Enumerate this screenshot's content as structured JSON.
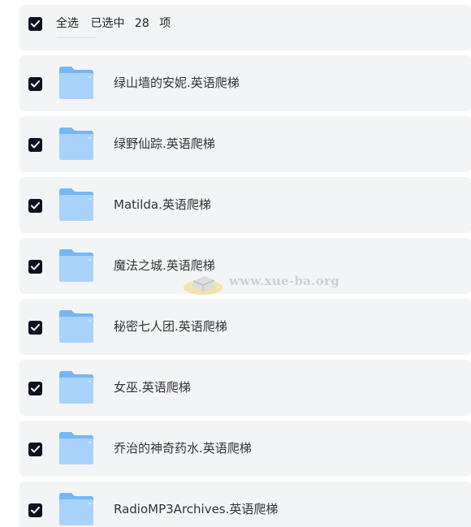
{
  "header": {
    "select_all": "全选",
    "selected_prefix": "已选中",
    "selected_count": "28",
    "selected_suffix": "项"
  },
  "items": [
    {
      "name": "绿山墙的安妮.英语爬梯"
    },
    {
      "name": "绿野仙踪.英语爬梯"
    },
    {
      "name": "Matilda.英语爬梯"
    },
    {
      "name": "魔法之城.英语爬梯"
    },
    {
      "name": "秘密七人团.英语爬梯"
    },
    {
      "name": "女巫.英语爬梯"
    },
    {
      "name": "乔治的神奇药水.英语爬梯"
    },
    {
      "name": "RadioMP3Archives.英语爬梯"
    }
  ],
  "watermark": {
    "text": "www.xue-ba.org"
  },
  "colors": {
    "row_bg": "#f3f4f6",
    "checkbox": "#0f1120",
    "folder_light": "#a9d2fb",
    "folder_dark": "#75b6f5"
  }
}
